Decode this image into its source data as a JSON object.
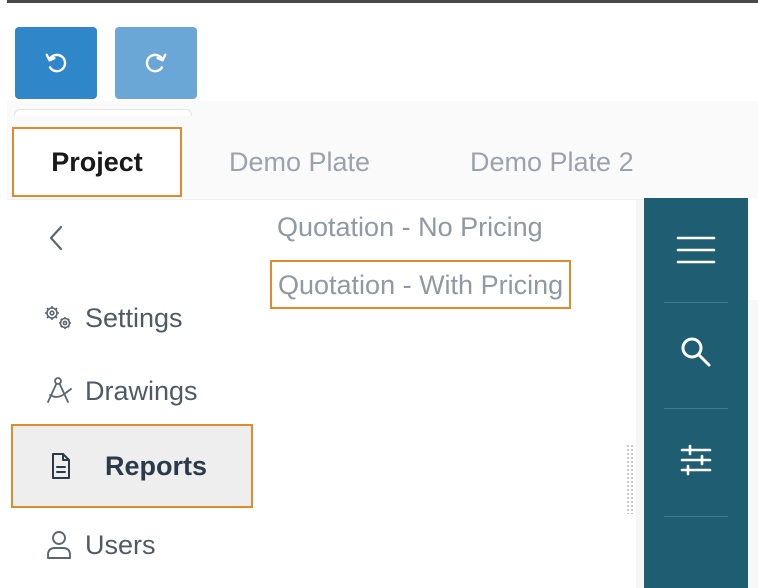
{
  "toolbar": {
    "undo_icon": "undo-icon",
    "redo_icon": "redo-icon"
  },
  "tabs": [
    {
      "label": "Project",
      "active": true
    },
    {
      "label": "Demo Plate",
      "active": false
    },
    {
      "label": "Demo Plate 2",
      "active": false
    }
  ],
  "sidebar": {
    "collapse_icon": "chevron-left-icon",
    "items": [
      {
        "label": "Settings",
        "icon": "gears-icon"
      },
      {
        "label": "Drawings",
        "icon": "compass-icon"
      },
      {
        "label": "Reports",
        "icon": "document-icon",
        "active": true
      },
      {
        "label": "Users",
        "icon": "user-icon"
      }
    ]
  },
  "reports": [
    {
      "label": "Quotation - No Pricing"
    },
    {
      "label": "Quotation - With Pricing",
      "highlighted": true
    }
  ],
  "rail": {
    "icons": [
      "menu-icon",
      "search-icon",
      "sliders-icon"
    ]
  },
  "colors": {
    "primary": "#2f86c8",
    "primary_light": "#6aa6d6",
    "rail": "#1f5d73",
    "highlight": "#e08a2c",
    "active_bar": "#2f6b3c"
  }
}
